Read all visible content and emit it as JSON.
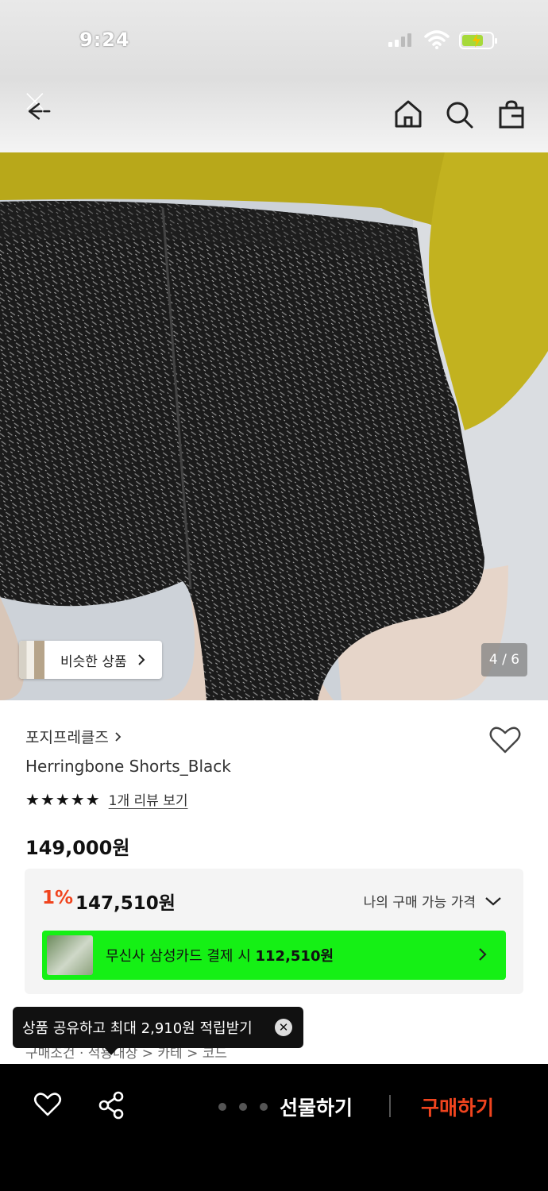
{
  "status": {
    "time": "9:24"
  },
  "gallery": {
    "similar_label": "비슷한 상품",
    "page_indicator": "4 / 6"
  },
  "product": {
    "brand": "포지프레클즈",
    "name": "Herringbone Shorts_Black",
    "stars": "★★★★★",
    "review_link": "1개 리뷰 보기",
    "price": "149,000원"
  },
  "price_box": {
    "discount_pct": "1%",
    "discount_price": "147,510원",
    "my_price_label": "나의 구매 가능 가격",
    "card_text_prefix": "무신사 삼성카드 결제 시",
    "card_price": "112,510원"
  },
  "tooltip": {
    "text": "상품 공유하고 최대 2,910원 적립받기",
    "behind_text": "구매조건  ·  적용대상  >  카테  >  코드"
  },
  "bottom_bar": {
    "gift_label": "선물하기",
    "buy_label": "구매하기"
  },
  "colors": {
    "accent_orange": "#f0441e",
    "card_banner_green": "#15f015",
    "bottom_bar_bg": "#000000"
  }
}
